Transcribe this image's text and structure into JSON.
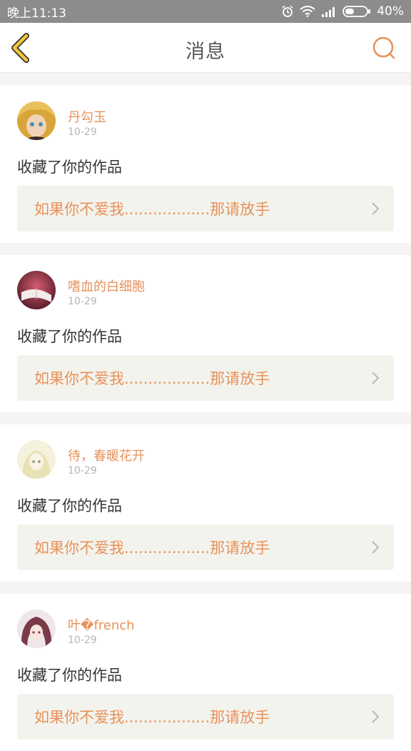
{
  "status_bar": {
    "time": "晚上11:13",
    "battery": "40%",
    "icons": [
      "alarm-icon",
      "wifi-icon",
      "signal-icon",
      "battery-icon"
    ]
  },
  "header": {
    "title": "消息",
    "back_icon": "chevron-left-icon",
    "search_icon": "search-icon"
  },
  "colors": {
    "accent": "#e8915a",
    "back_icon": "#f0c63a"
  },
  "messages": [
    {
      "user": "丹勾玉",
      "time": "10-29",
      "action": "收藏了你的作品",
      "work_title": "如果你不爱我..................那请放手"
    },
    {
      "user": "嗜血的白细胞",
      "time": "10-29",
      "action": "收藏了你的作品",
      "work_title": "如果你不爱我..................那请放手"
    },
    {
      "user": "待，春暖花开",
      "time": "10-29",
      "action": "收藏了你的作品",
      "work_title": "如果你不爱我..................那请放手"
    },
    {
      "user": "叶�french",
      "time": "10-29",
      "action": "收藏了你的作品",
      "work_title": "如果你不爱我..................那请放手"
    }
  ]
}
